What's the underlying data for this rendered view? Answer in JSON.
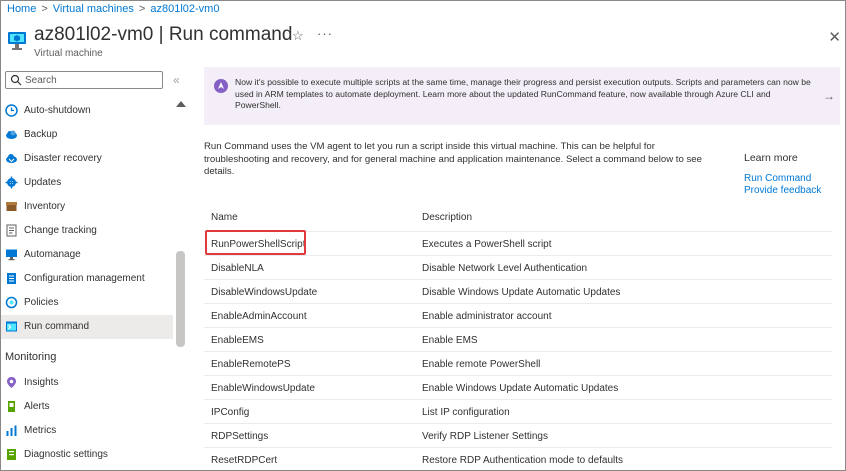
{
  "breadcrumb": {
    "home": "Home",
    "vms": "Virtual machines",
    "vm": "az801l02-vm0"
  },
  "header": {
    "title": "az801l02-vm0 | Run command",
    "subtitle": "Virtual machine"
  },
  "colors": {
    "accent": "#0078d4",
    "highlight": "#e0393e",
    "banner_bg": "#f3eef7",
    "banner_icon": "#8661c5",
    "selected_bg": "#edebe9"
  },
  "sidebar": {
    "search_placeholder": "Search",
    "items": [
      {
        "label": "Auto-shutdown",
        "icon": "clock-icon"
      },
      {
        "label": "Backup",
        "icon": "cloud-backup-icon"
      },
      {
        "label": "Disaster recovery",
        "icon": "disaster-recovery-icon"
      },
      {
        "label": "Updates",
        "icon": "gear-update-icon"
      },
      {
        "label": "Inventory",
        "icon": "inventory-icon"
      },
      {
        "label": "Change tracking",
        "icon": "change-tracking-icon"
      },
      {
        "label": "Automanage",
        "icon": "monitor-icon"
      },
      {
        "label": "Configuration management",
        "icon": "document-icon"
      },
      {
        "label": "Policies",
        "icon": "policy-icon"
      },
      {
        "label": "Run command",
        "icon": "run-command-icon",
        "selected": true
      }
    ],
    "monitoring_label": "Monitoring",
    "monitoring_items": [
      {
        "label": "Insights",
        "icon": "insights-icon"
      },
      {
        "label": "Alerts",
        "icon": "alert-icon"
      },
      {
        "label": "Metrics",
        "icon": "metrics-icon"
      },
      {
        "label": "Diagnostic settings",
        "icon": "diagnostic-icon"
      }
    ]
  },
  "banner": {
    "text": "Now it's possible to execute multiple scripts at the same time, manage their progress and persist execution outputs. Scripts and parameters can now be used in ARM templates to automate deployment. Learn more about the updated RunCommand feature, now available through Azure CLI and PowerShell."
  },
  "main": {
    "description": "Run Command uses the VM agent to let you run a script inside this virtual machine. This can be helpful for troubleshooting and recovery, and for general machine and application maintenance. Select a command below to see details.",
    "learn_more": "Learn more",
    "link_run_command": "Run Command",
    "link_feedback": "Provide feedback"
  },
  "table": {
    "headers": [
      "Name",
      "Description"
    ],
    "rows": [
      [
        "RunPowerShellScript",
        "Executes a PowerShell script"
      ],
      [
        "DisableNLA",
        "Disable Network Level Authentication"
      ],
      [
        "DisableWindowsUpdate",
        "Disable Windows Update Automatic Updates"
      ],
      [
        "EnableAdminAccount",
        "Enable administrator account"
      ],
      [
        "EnableEMS",
        "Enable EMS"
      ],
      [
        "EnableRemotePS",
        "Enable remote PowerShell"
      ],
      [
        "EnableWindowsUpdate",
        "Enable Windows Update Automatic Updates"
      ],
      [
        "IPConfig",
        "List IP configuration"
      ],
      [
        "RDPSettings",
        "Verify RDP Listener Settings"
      ],
      [
        "ResetRDPCert",
        "Restore RDP Authentication mode to defaults"
      ]
    ]
  }
}
